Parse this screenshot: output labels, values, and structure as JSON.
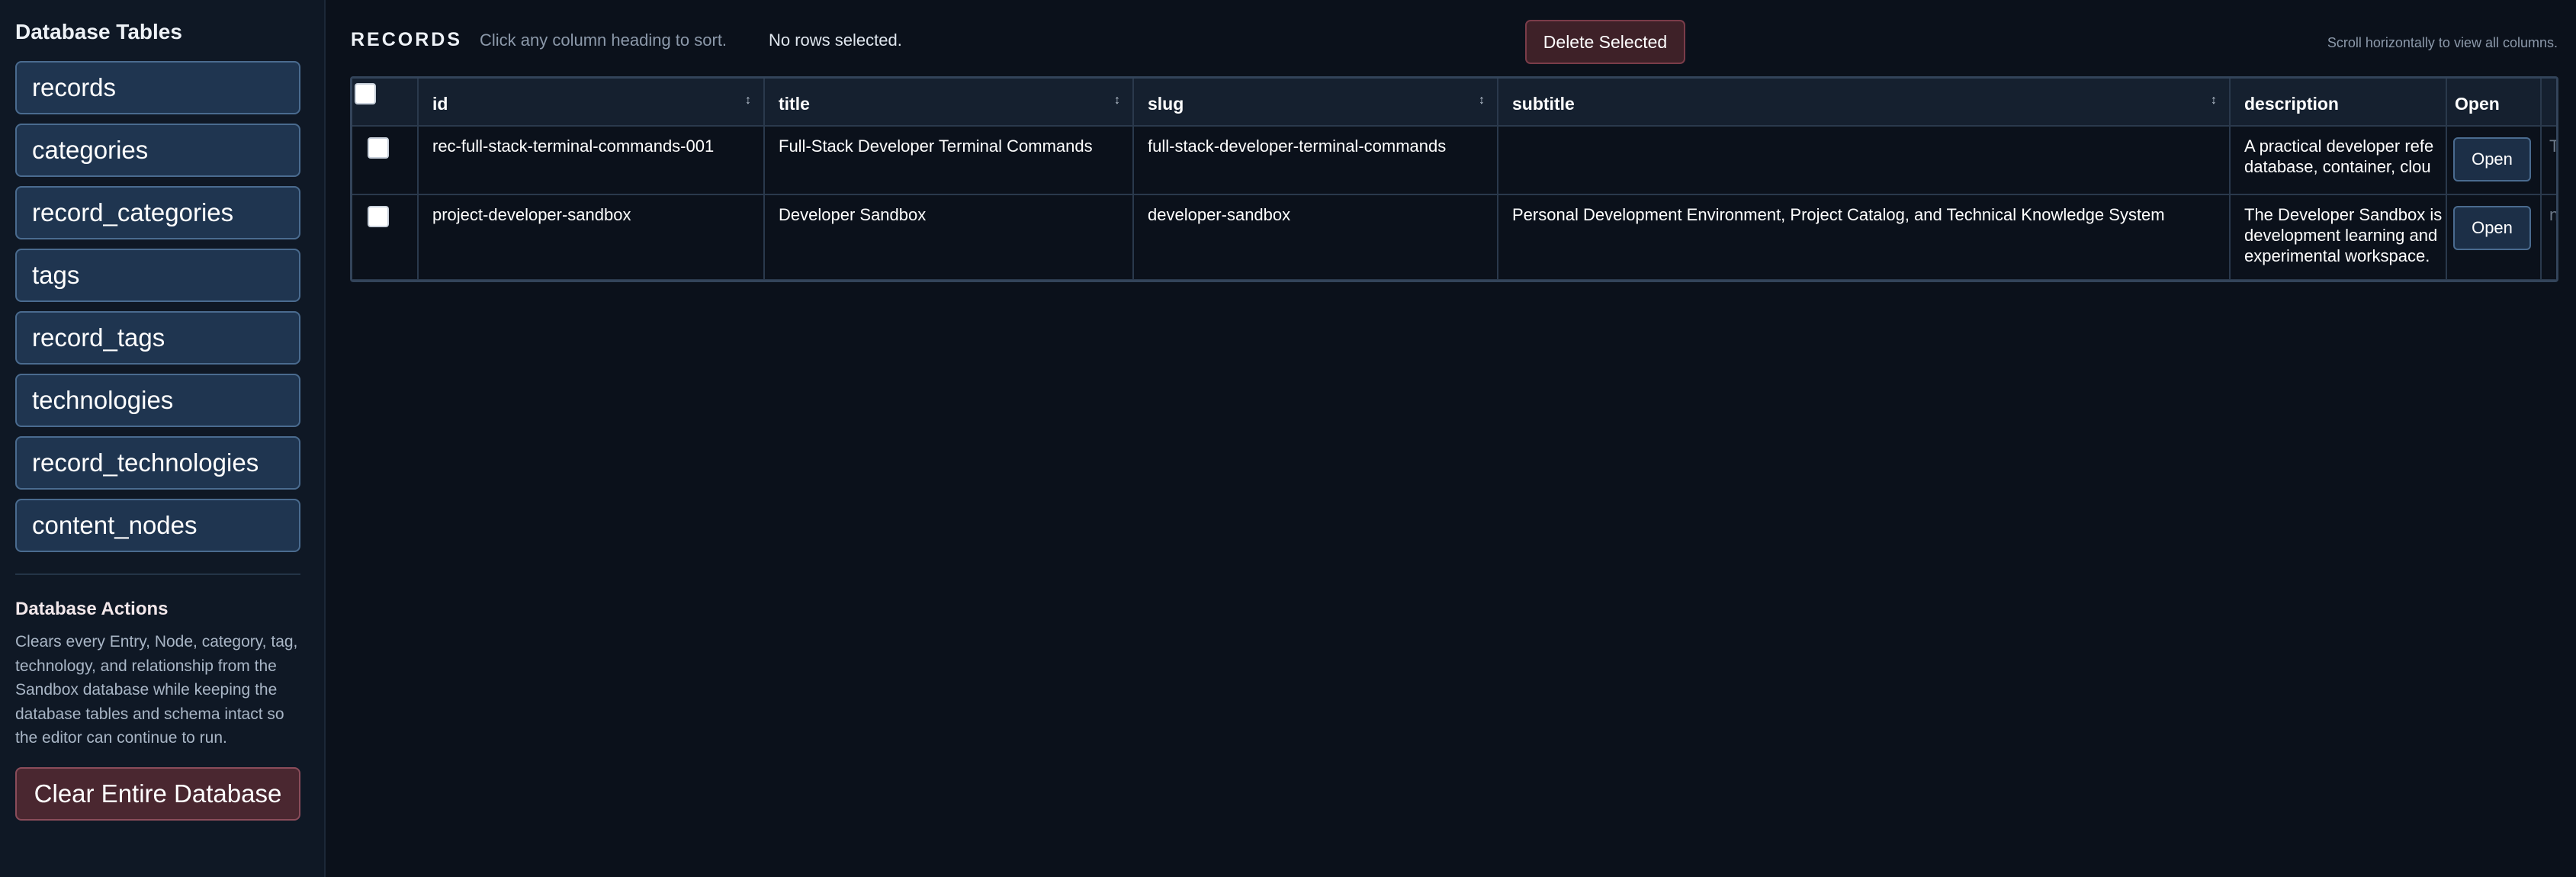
{
  "sidebar": {
    "title": "Database Tables",
    "tables": [
      {
        "label": "records"
      },
      {
        "label": "categories"
      },
      {
        "label": "record_categories"
      },
      {
        "label": "tags"
      },
      {
        "label": "record_tags"
      },
      {
        "label": "technologies"
      },
      {
        "label": "record_technologies"
      },
      {
        "label": "content_nodes"
      }
    ],
    "actions_title": "Database Actions",
    "actions_description": "Clears every Entry, Node, category, tag, technology, and relationship from the Sandbox database while keeping the database tables and schema intact so the editor can continue to run.",
    "clear_button_label": "Clear Entire Database"
  },
  "toolbar": {
    "title": "RECORDS",
    "sort_hint": "Click any column heading to sort.",
    "selection_status": "No rows selected.",
    "delete_button_label": "Delete Selected",
    "scroll_hint": "Scroll horizontally to view all columns."
  },
  "table": {
    "columns": [
      {
        "label": "id",
        "sortable": true
      },
      {
        "label": "title",
        "sortable": true
      },
      {
        "label": "slug",
        "sortable": true
      },
      {
        "label": "subtitle",
        "sortable": true
      },
      {
        "label": "description",
        "sortable": false
      },
      {
        "label": "Open",
        "sortable": false
      }
    ],
    "rows": [
      {
        "id": "rec-full-stack-terminal-commands-001",
        "title": "Full-Stack Developer Terminal Commands",
        "slug": "full-stack-developer-terminal-commands",
        "subtitle": "",
        "description_lines": [
          "A practical developer refe",
          "database, container, clou"
        ],
        "open_label": "Open",
        "overflow_text": "T"
      },
      {
        "id": "project-developer-sandbox",
        "title": "Developer Sandbox",
        "slug": "developer-sandbox",
        "subtitle": "Personal Development Environment, Project Catalog, and Technical Knowledge System",
        "description_lines": [
          "The Developer Sandbox is",
          "development learning and",
          "experimental workspace."
        ],
        "open_label": "Open",
        "overflow_text": "n"
      }
    ]
  },
  "colors": {
    "background": "#0b111b",
    "sidebar_background": "#0f1825",
    "button_blue": "#1f3550",
    "button_danger": "#4a2730"
  },
  "icons": {
    "sort": "sort-updown-icon"
  }
}
